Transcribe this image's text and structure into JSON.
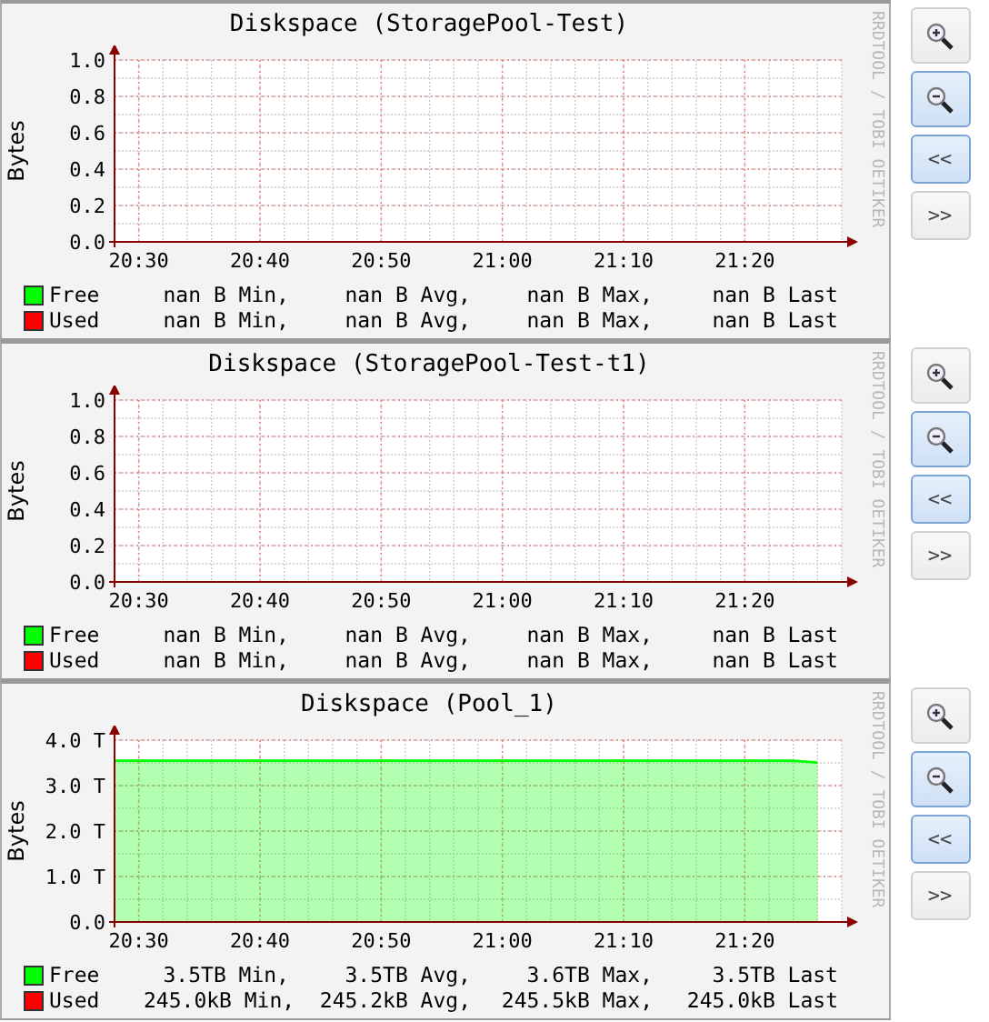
{
  "panels": [
    {
      "title": "Diskspace (StoragePool-Test)",
      "credit": "RRDTOOL / TOBI OETIKER",
      "chart_data": {
        "type": "area",
        "ylabel": "Bytes",
        "grid": true,
        "ylim": [
          0,
          1
        ],
        "categories": [
          null,
          "20:30",
          null,
          null,
          null,
          null,
          "20:40",
          null,
          null,
          null,
          null,
          "20:50",
          null,
          null,
          null,
          null,
          "21:00",
          null,
          null,
          null,
          null,
          "21:10",
          null,
          null,
          null,
          null,
          "21:20",
          null,
          null,
          null,
          null
        ],
        "yticks": [
          {
            "value": 0,
            "label": "0.0"
          },
          {
            "value": 0.2,
            "label": "0.2"
          },
          {
            "value": 0.4,
            "label": "0.4"
          },
          {
            "value": 0.6,
            "label": "0.6"
          },
          {
            "value": 0.8,
            "label": "0.8"
          },
          {
            "value": 1,
            "label": "1.0"
          }
        ],
        "series": [
          {
            "name": "Free",
            "color": "#00ff00",
            "values": [
              null,
              null,
              null,
              null,
              null,
              null,
              null,
              null,
              null,
              null,
              null,
              null,
              null,
              null,
              null,
              null,
              null,
              null,
              null,
              null,
              null,
              null,
              null,
              null,
              null,
              null,
              null,
              null,
              null,
              null,
              null
            ]
          },
          {
            "name": "Used",
            "color": "#ff0000",
            "values": [
              null,
              null,
              null,
              null,
              null,
              null,
              null,
              null,
              null,
              null,
              null,
              null,
              null,
              null,
              null,
              null,
              null,
              null,
              null,
              null,
              null,
              null,
              null,
              null,
              null,
              null,
              null,
              null,
              null,
              null,
              null
            ]
          }
        ]
      },
      "legend": [
        {
          "min": "nan B Min,",
          "avg": "nan B Avg,",
          "max": "nan B Max,",
          "last": "nan B Last"
        },
        {
          "min": "nan B Min,",
          "avg": "nan B Avg,",
          "max": "nan B Max,",
          "last": "nan B Last"
        }
      ],
      "buttons": [
        {
          "kind": "zoom-in",
          "highlighted": false
        },
        {
          "kind": "zoom-out",
          "highlighted": true
        },
        {
          "kind": "text",
          "label": "<<",
          "highlighted": true
        },
        {
          "kind": "text",
          "label": ">>",
          "highlighted": false
        }
      ]
    },
    {
      "title": "Diskspace (StoragePool-Test-t1)",
      "credit": "RRDTOOL / TOBI OETIKER",
      "chart_data": {
        "type": "area",
        "ylabel": "Bytes",
        "grid": true,
        "ylim": [
          0,
          1
        ],
        "categories": [
          null,
          "20:30",
          null,
          null,
          null,
          null,
          "20:40",
          null,
          null,
          null,
          null,
          "20:50",
          null,
          null,
          null,
          null,
          "21:00",
          null,
          null,
          null,
          null,
          "21:10",
          null,
          null,
          null,
          null,
          "21:20",
          null,
          null,
          null,
          null
        ],
        "yticks": [
          {
            "value": 0,
            "label": "0.0"
          },
          {
            "value": 0.2,
            "label": "0.2"
          },
          {
            "value": 0.4,
            "label": "0.4"
          },
          {
            "value": 0.6,
            "label": "0.6"
          },
          {
            "value": 0.8,
            "label": "0.8"
          },
          {
            "value": 1,
            "label": "1.0"
          }
        ],
        "series": [
          {
            "name": "Free",
            "color": "#00ff00",
            "values": [
              null,
              null,
              null,
              null,
              null,
              null,
              null,
              null,
              null,
              null,
              null,
              null,
              null,
              null,
              null,
              null,
              null,
              null,
              null,
              null,
              null,
              null,
              null,
              null,
              null,
              null,
              null,
              null,
              null,
              null,
              null
            ]
          },
          {
            "name": "Used",
            "color": "#ff0000",
            "values": [
              null,
              null,
              null,
              null,
              null,
              null,
              null,
              null,
              null,
              null,
              null,
              null,
              null,
              null,
              null,
              null,
              null,
              null,
              null,
              null,
              null,
              null,
              null,
              null,
              null,
              null,
              null,
              null,
              null,
              null,
              null
            ]
          }
        ]
      },
      "legend": [
        {
          "min": "nan B Min,",
          "avg": "nan B Avg,",
          "max": "nan B Max,",
          "last": "nan B Last"
        },
        {
          "min": "nan B Min,",
          "avg": "nan B Avg,",
          "max": "nan B Max,",
          "last": "nan B Last"
        }
      ],
      "buttons": [
        {
          "kind": "zoom-in",
          "highlighted": false
        },
        {
          "kind": "zoom-out",
          "highlighted": true
        },
        {
          "kind": "text",
          "label": "<<",
          "highlighted": true
        },
        {
          "kind": "text",
          "label": ">>",
          "highlighted": false
        }
      ]
    },
    {
      "title": "Diskspace (Pool_1)",
      "credit": "RRDTOOL / TOBI OETIKER",
      "chart_data": {
        "type": "area",
        "ylabel": "Bytes",
        "grid": true,
        "ylim": [
          0,
          4
        ],
        "categories": [
          null,
          "20:30",
          null,
          null,
          null,
          null,
          "20:40",
          null,
          null,
          null,
          null,
          "20:50",
          null,
          null,
          null,
          null,
          "21:00",
          null,
          null,
          null,
          null,
          "21:10",
          null,
          null,
          null,
          null,
          "21:20",
          null,
          null,
          null,
          null
        ],
        "yticks": [
          {
            "value": 0,
            "label": "0.0"
          },
          {
            "value": 1,
            "label": "1.0 T"
          },
          {
            "value": 2,
            "label": "2.0 T"
          },
          {
            "value": 3,
            "label": "3.0 T"
          },
          {
            "value": 4,
            "label": "4.0 T"
          }
        ],
        "series": [
          {
            "name": "Free",
            "color": "#00ff00",
            "values": [
              3.55,
              3.55,
              3.55,
              3.55,
              3.55,
              3.55,
              3.55,
              3.55,
              3.55,
              3.55,
              3.55,
              3.55,
              3.55,
              3.55,
              3.55,
              3.55,
              3.55,
              3.55,
              3.55,
              3.55,
              3.55,
              3.55,
              3.55,
              3.55,
              3.55,
              3.55,
              3.55,
              3.55,
              3.55,
              3.51,
              null
            ]
          },
          {
            "name": "Used",
            "color": "#ff0000",
            "values": [
              null,
              null,
              null,
              null,
              null,
              null,
              null,
              null,
              null,
              null,
              null,
              null,
              null,
              null,
              null,
              null,
              null,
              null,
              null,
              null,
              null,
              null,
              null,
              null,
              null,
              null,
              null,
              null,
              null,
              null,
              null
            ]
          }
        ]
      },
      "legend": [
        {
          "min": "3.5TB Min,",
          "avg": "3.5TB Avg,",
          "max": "3.6TB Max,",
          "last": "3.5TB Last"
        },
        {
          "min": "245.0kB Min,",
          "avg": "245.2kB Avg,",
          "max": "245.5kB Max,",
          "last": "245.0kB Last"
        }
      ],
      "buttons": [
        {
          "kind": "zoom-in",
          "highlighted": false
        },
        {
          "kind": "zoom-out",
          "highlighted": true
        },
        {
          "kind": "text",
          "label": "<<",
          "highlighted": true
        },
        {
          "kind": "text",
          "label": ">>",
          "highlighted": false
        }
      ]
    }
  ]
}
